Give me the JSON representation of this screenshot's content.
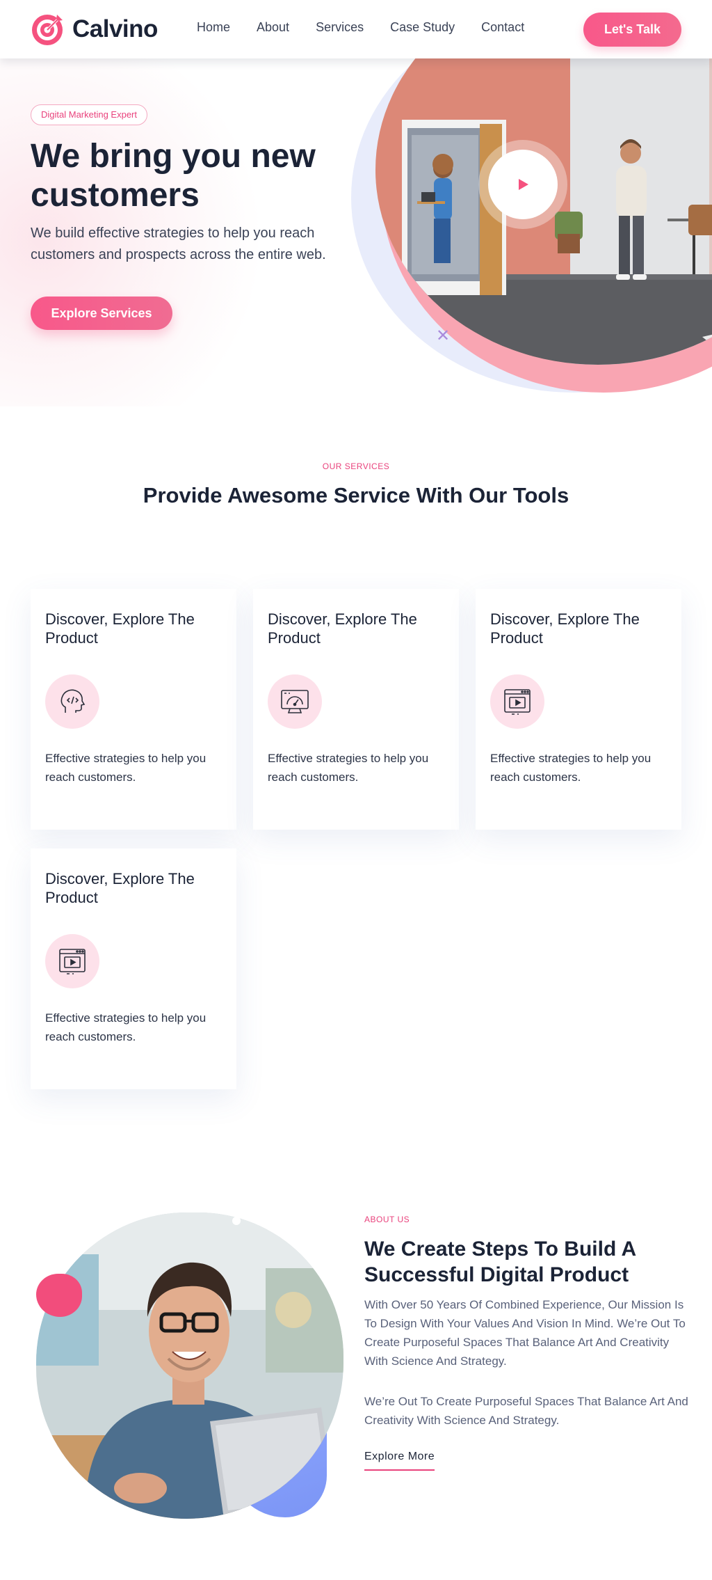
{
  "brand": {
    "name": "Calvino",
    "accent": "#f8588a",
    "logo_icon": "target-icon"
  },
  "nav": {
    "items": [
      {
        "label": "Home"
      },
      {
        "label": "About"
      },
      {
        "label": "Services"
      },
      {
        "label": "Case Study"
      },
      {
        "label": "Contact"
      }
    ],
    "cta_label": "Let's Talk"
  },
  "hero": {
    "badge": "Digital Marketing Expert",
    "title": "We bring you new customers",
    "subtitle": "We build effective strategies to help you reach customers and prospects across the entire web.",
    "cta_label": "Explore Services",
    "play_icon": "play-icon"
  },
  "services": {
    "kicker": "OUR SERVICES",
    "title": "Provide Awesome Service With Our Tools",
    "cards": [
      {
        "title": "Discover, Explore The Product",
        "icon": "ai-head-code-icon",
        "text": "Effective strategies to help you reach customers."
      },
      {
        "title": "Discover, Explore The Product",
        "icon": "dashboard-monitor-icon",
        "text": "Effective strategies to help you reach customers."
      },
      {
        "title": "Discover, Explore The Product",
        "icon": "video-browser-icon",
        "text": "Effective strategies to help you reach customers."
      },
      {
        "title": "Discover, Explore The Product",
        "icon": "video-browser-icon",
        "text": "Effective strategies to help you reach customers."
      }
    ]
  },
  "about": {
    "kicker": "ABOUT US",
    "title": "We Create Steps To Build A Successful Digital Product",
    "paragraph1": "With Over 50 Years Of Combined Experience, Our Mission Is To Design With Your Values And Vision In Mind. We’re Out To Create Purposeful Spaces That Balance Art And Creativity With Science And Strategy.",
    "paragraph2": "We’re Out To Create Purposeful Spaces That Balance Art And Creativity With Science And Strategy.",
    "link_label": "Explore More"
  }
}
